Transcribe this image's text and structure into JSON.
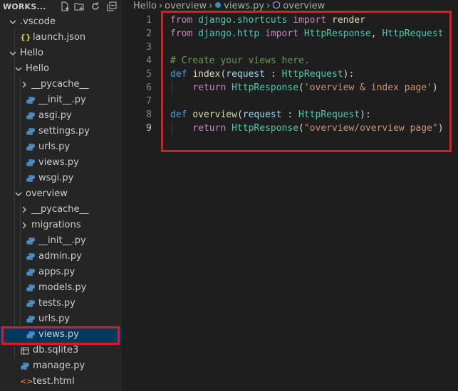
{
  "explorer": {
    "title": "WORKS...",
    "actions": [
      "new-file-icon",
      "new-folder-icon",
      "refresh-icon",
      "collapse-all-icon"
    ],
    "items": [
      {
        "label": ".vscode",
        "type": "folder",
        "expanded": true,
        "depth": 1
      },
      {
        "label": "launch.json",
        "type": "json",
        "depth": 2,
        "icon_text": "{}"
      },
      {
        "label": "Hello",
        "type": "folder",
        "expanded": true,
        "depth": 1
      },
      {
        "label": "Hello",
        "type": "folder",
        "expanded": true,
        "depth": 2
      },
      {
        "label": "__pycache__",
        "type": "folder",
        "expanded": false,
        "depth": 3
      },
      {
        "label": "__init__.py",
        "type": "python",
        "depth": 3
      },
      {
        "label": "asgi.py",
        "type": "python",
        "depth": 3
      },
      {
        "label": "settings.py",
        "type": "python",
        "depth": 3
      },
      {
        "label": "urls.py",
        "type": "python",
        "depth": 3
      },
      {
        "label": "views.py",
        "type": "python",
        "depth": 3
      },
      {
        "label": "wsgi.py",
        "type": "python",
        "depth": 3
      },
      {
        "label": "overview",
        "type": "folder",
        "expanded": true,
        "depth": 2
      },
      {
        "label": "__pycache__",
        "type": "folder",
        "expanded": false,
        "depth": 3
      },
      {
        "label": "migrations",
        "type": "folder",
        "expanded": false,
        "depth": 3
      },
      {
        "label": "__init__.py",
        "type": "python",
        "depth": 3
      },
      {
        "label": "admin.py",
        "type": "python",
        "depth": 3
      },
      {
        "label": "apps.py",
        "type": "python",
        "depth": 3
      },
      {
        "label": "models.py",
        "type": "python",
        "depth": 3
      },
      {
        "label": "tests.py",
        "type": "python",
        "depth": 3
      },
      {
        "label": "urls.py",
        "type": "python",
        "depth": 3
      },
      {
        "label": "views.py",
        "type": "python",
        "depth": 3,
        "selected": true
      },
      {
        "label": "db.sqlite3",
        "type": "db",
        "depth": 2
      },
      {
        "label": "manage.py",
        "type": "python",
        "depth": 2
      },
      {
        "label": "test.html",
        "type": "html",
        "depth": 2,
        "icon_text": "<>"
      }
    ]
  },
  "breadcrumb": [
    "Hello",
    "›",
    "overview",
    "›",
    "views.py",
    "›",
    "overview"
  ],
  "editor": {
    "active_line": 9,
    "lines": [
      {
        "n": "1",
        "tokens": [
          {
            "t": "from",
            "c": "k-purple"
          },
          {
            "t": " django.shortcuts ",
            "c": "k-type"
          },
          {
            "t": "import",
            "c": "k-purple"
          },
          {
            "t": " render",
            "c": "k-func"
          }
        ]
      },
      {
        "n": "2",
        "tokens": [
          {
            "t": "from",
            "c": "k-purple"
          },
          {
            "t": " django.http ",
            "c": "k-type"
          },
          {
            "t": "import",
            "c": "k-purple"
          },
          {
            "t": " HttpResponse",
            "c": "k-type"
          },
          {
            "t": ", ",
            "c": ""
          },
          {
            "t": "HttpRequest",
            "c": "k-type"
          }
        ]
      },
      {
        "n": "3",
        "tokens": []
      },
      {
        "n": "4",
        "tokens": [
          {
            "t": "# Create your views here.",
            "c": "k-com"
          }
        ]
      },
      {
        "n": "5",
        "tokens": [
          {
            "t": "def",
            "c": "k-blue"
          },
          {
            "t": " ",
            "c": ""
          },
          {
            "t": "index",
            "c": "k-func"
          },
          {
            "t": "(",
            "c": ""
          },
          {
            "t": "request",
            "c": "k-param"
          },
          {
            "t": " : ",
            "c": ""
          },
          {
            "t": "HttpRequest",
            "c": "k-type"
          },
          {
            "t": "):",
            "c": ""
          }
        ]
      },
      {
        "n": "6",
        "tokens": [
          {
            "t": "    ",
            "c": ""
          },
          {
            "t": "return",
            "c": "k-purple"
          },
          {
            "t": " ",
            "c": ""
          },
          {
            "t": "HttpResponse",
            "c": "k-type"
          },
          {
            "t": "(",
            "c": ""
          },
          {
            "t": "'overview & index page'",
            "c": "k-str"
          },
          {
            "t": ")",
            "c": ""
          }
        ]
      },
      {
        "n": "7",
        "tokens": []
      },
      {
        "n": "8",
        "tokens": [
          {
            "t": "def",
            "c": "k-blue"
          },
          {
            "t": " ",
            "c": ""
          },
          {
            "t": "overview",
            "c": "k-func"
          },
          {
            "t": "(",
            "c": ""
          },
          {
            "t": "request",
            "c": "k-param"
          },
          {
            "t": " : ",
            "c": ""
          },
          {
            "t": "HttpRequest",
            "c": "k-type"
          },
          {
            "t": "):",
            "c": ""
          }
        ]
      },
      {
        "n": "9",
        "tokens": [
          {
            "t": "    ",
            "c": ""
          },
          {
            "t": "return",
            "c": "k-purple"
          },
          {
            "t": " ",
            "c": ""
          },
          {
            "t": "HttpResponse",
            "c": "k-type"
          },
          {
            "t": "(",
            "c": ""
          },
          {
            "t": "\"overview/overview page\"",
            "c": "k-str"
          },
          {
            "t": ")",
            "c": ""
          }
        ]
      }
    ]
  },
  "colors": {
    "highlight": "#e01a22",
    "selection": "#04395e",
    "python_icon": "#3b86c6",
    "json_icon": "#cbcb41",
    "html_icon": "#e37933"
  }
}
